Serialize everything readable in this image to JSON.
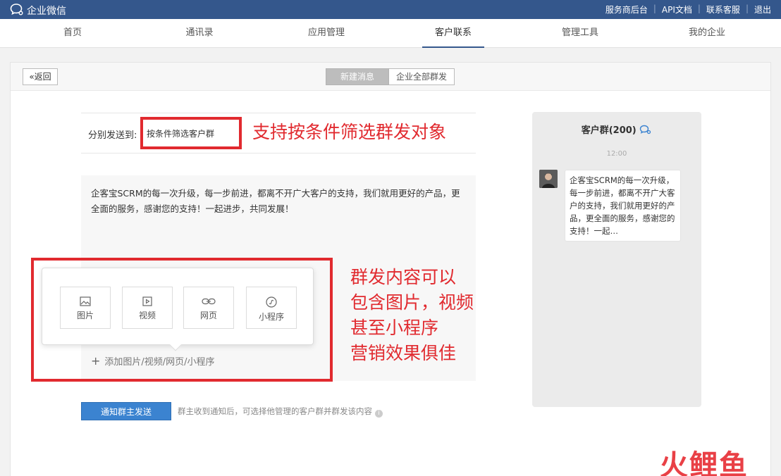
{
  "app": {
    "title": "企业微信"
  },
  "top_links": [
    "服务商后台",
    "API文档",
    "联系客服",
    "退出"
  ],
  "nav": {
    "tabs": [
      {
        "label": "首页"
      },
      {
        "label": "通讯录"
      },
      {
        "label": "应用管理"
      },
      {
        "label": "客户联系"
      },
      {
        "label": "管理工具"
      },
      {
        "label": "我的企业"
      }
    ],
    "active": "客户联系"
  },
  "header": {
    "back_label": "返回",
    "back_icon": "double-chevron-left-icon",
    "seg_new": "新建消息",
    "seg_all": "企业全部群发"
  },
  "form": {
    "send_label": "分别发送到:",
    "send_value": "按条件筛选客户群",
    "message": "企客宝SCRM的每一次升级，每一步前进，都离不开广大客户的支持，我们就用更好的产品，更全面的服务，感谢您的支持！一起进步，共同发展！",
    "media": [
      {
        "label": "图片",
        "icon": "image-icon"
      },
      {
        "label": "视频",
        "icon": "video-icon"
      },
      {
        "label": "网页",
        "icon": "link-icon"
      },
      {
        "label": "小程序",
        "icon": "mini-program-icon"
      }
    ],
    "add_label": "添加图片/视频/网页/小程序",
    "notify_button": "通知群主发送",
    "hint": "群主收到通知后，可选择他管理的客户群并群发该内容"
  },
  "annotations": {
    "filter": "支持按条件筛选群发对象",
    "content": [
      "群发内容可以",
      "包含图片，视频",
      "甚至小程序",
      "营销效果俱佳"
    ],
    "color": "#e12a2f"
  },
  "preview": {
    "title": "客户群(200)",
    "time": "12:00",
    "message": "企客宝SCRM的每一次升级，每一步前进，都离不开广大客户的支持，我们就用更好的产品，更全面的服务，感谢您的支持！一起…"
  },
  "watermark": "火鲤鱼",
  "colors": {
    "topbar": "#34578c",
    "primary_button": "#3b83d0",
    "annotation": "#e12a2f"
  }
}
